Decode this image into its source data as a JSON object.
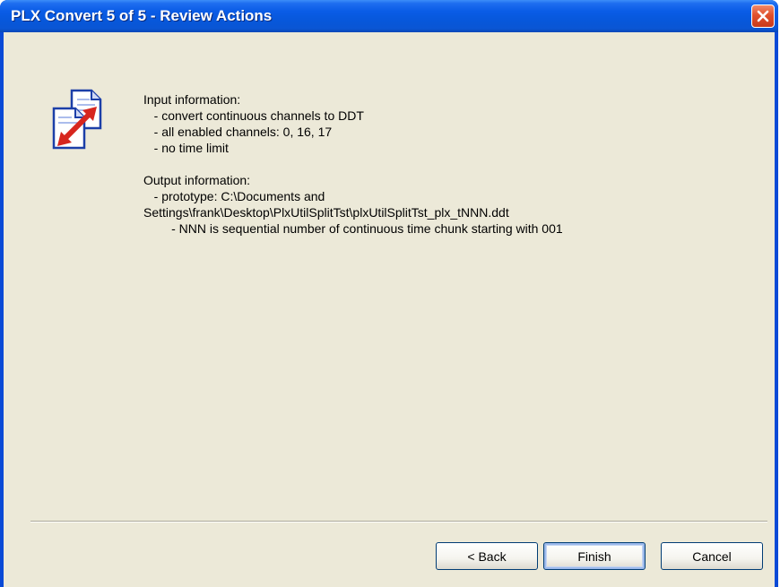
{
  "window": {
    "title": "PLX Convert 5 of 5 - Review Actions"
  },
  "icons": {
    "app": "convert-documents-icon",
    "close": "close-icon"
  },
  "input_info": {
    "heading": "Input information:",
    "items": [
      "   - convert continuous channels to DDT",
      "   - all enabled channels: 0, 16, 17",
      "   - no time limit"
    ]
  },
  "output_info": {
    "heading": "Output information:",
    "lines": [
      "   - prototype: C:\\Documents and",
      "Settings\\frank\\Desktop\\PlxUtilSplitTst\\plxUtilSplitTst_plx_tNNN.ddt",
      "        - NNN is sequential number of continuous time chunk starting with 001"
    ]
  },
  "buttons": {
    "back": "< Back",
    "finish": "Finish",
    "cancel": "Cancel"
  },
  "colors": {
    "titlebar": "#0a5ce6",
    "client": "#ece9d8",
    "close": "#e0502c"
  }
}
